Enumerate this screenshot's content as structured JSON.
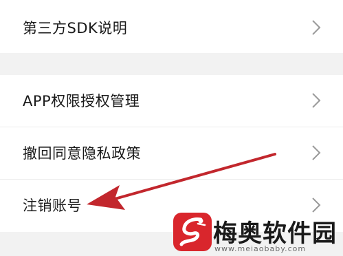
{
  "menu": {
    "items": [
      {
        "label": "第三方SDK说明"
      },
      {
        "label": "APP权限授权管理"
      },
      {
        "label": "撤回同意隐私政策"
      },
      {
        "label": "注销账号"
      }
    ]
  },
  "annotation": {
    "arrow_color": "#c2272d"
  },
  "watermark": {
    "name": "梅奥软件园",
    "url": "www.meiaobaby.com"
  }
}
